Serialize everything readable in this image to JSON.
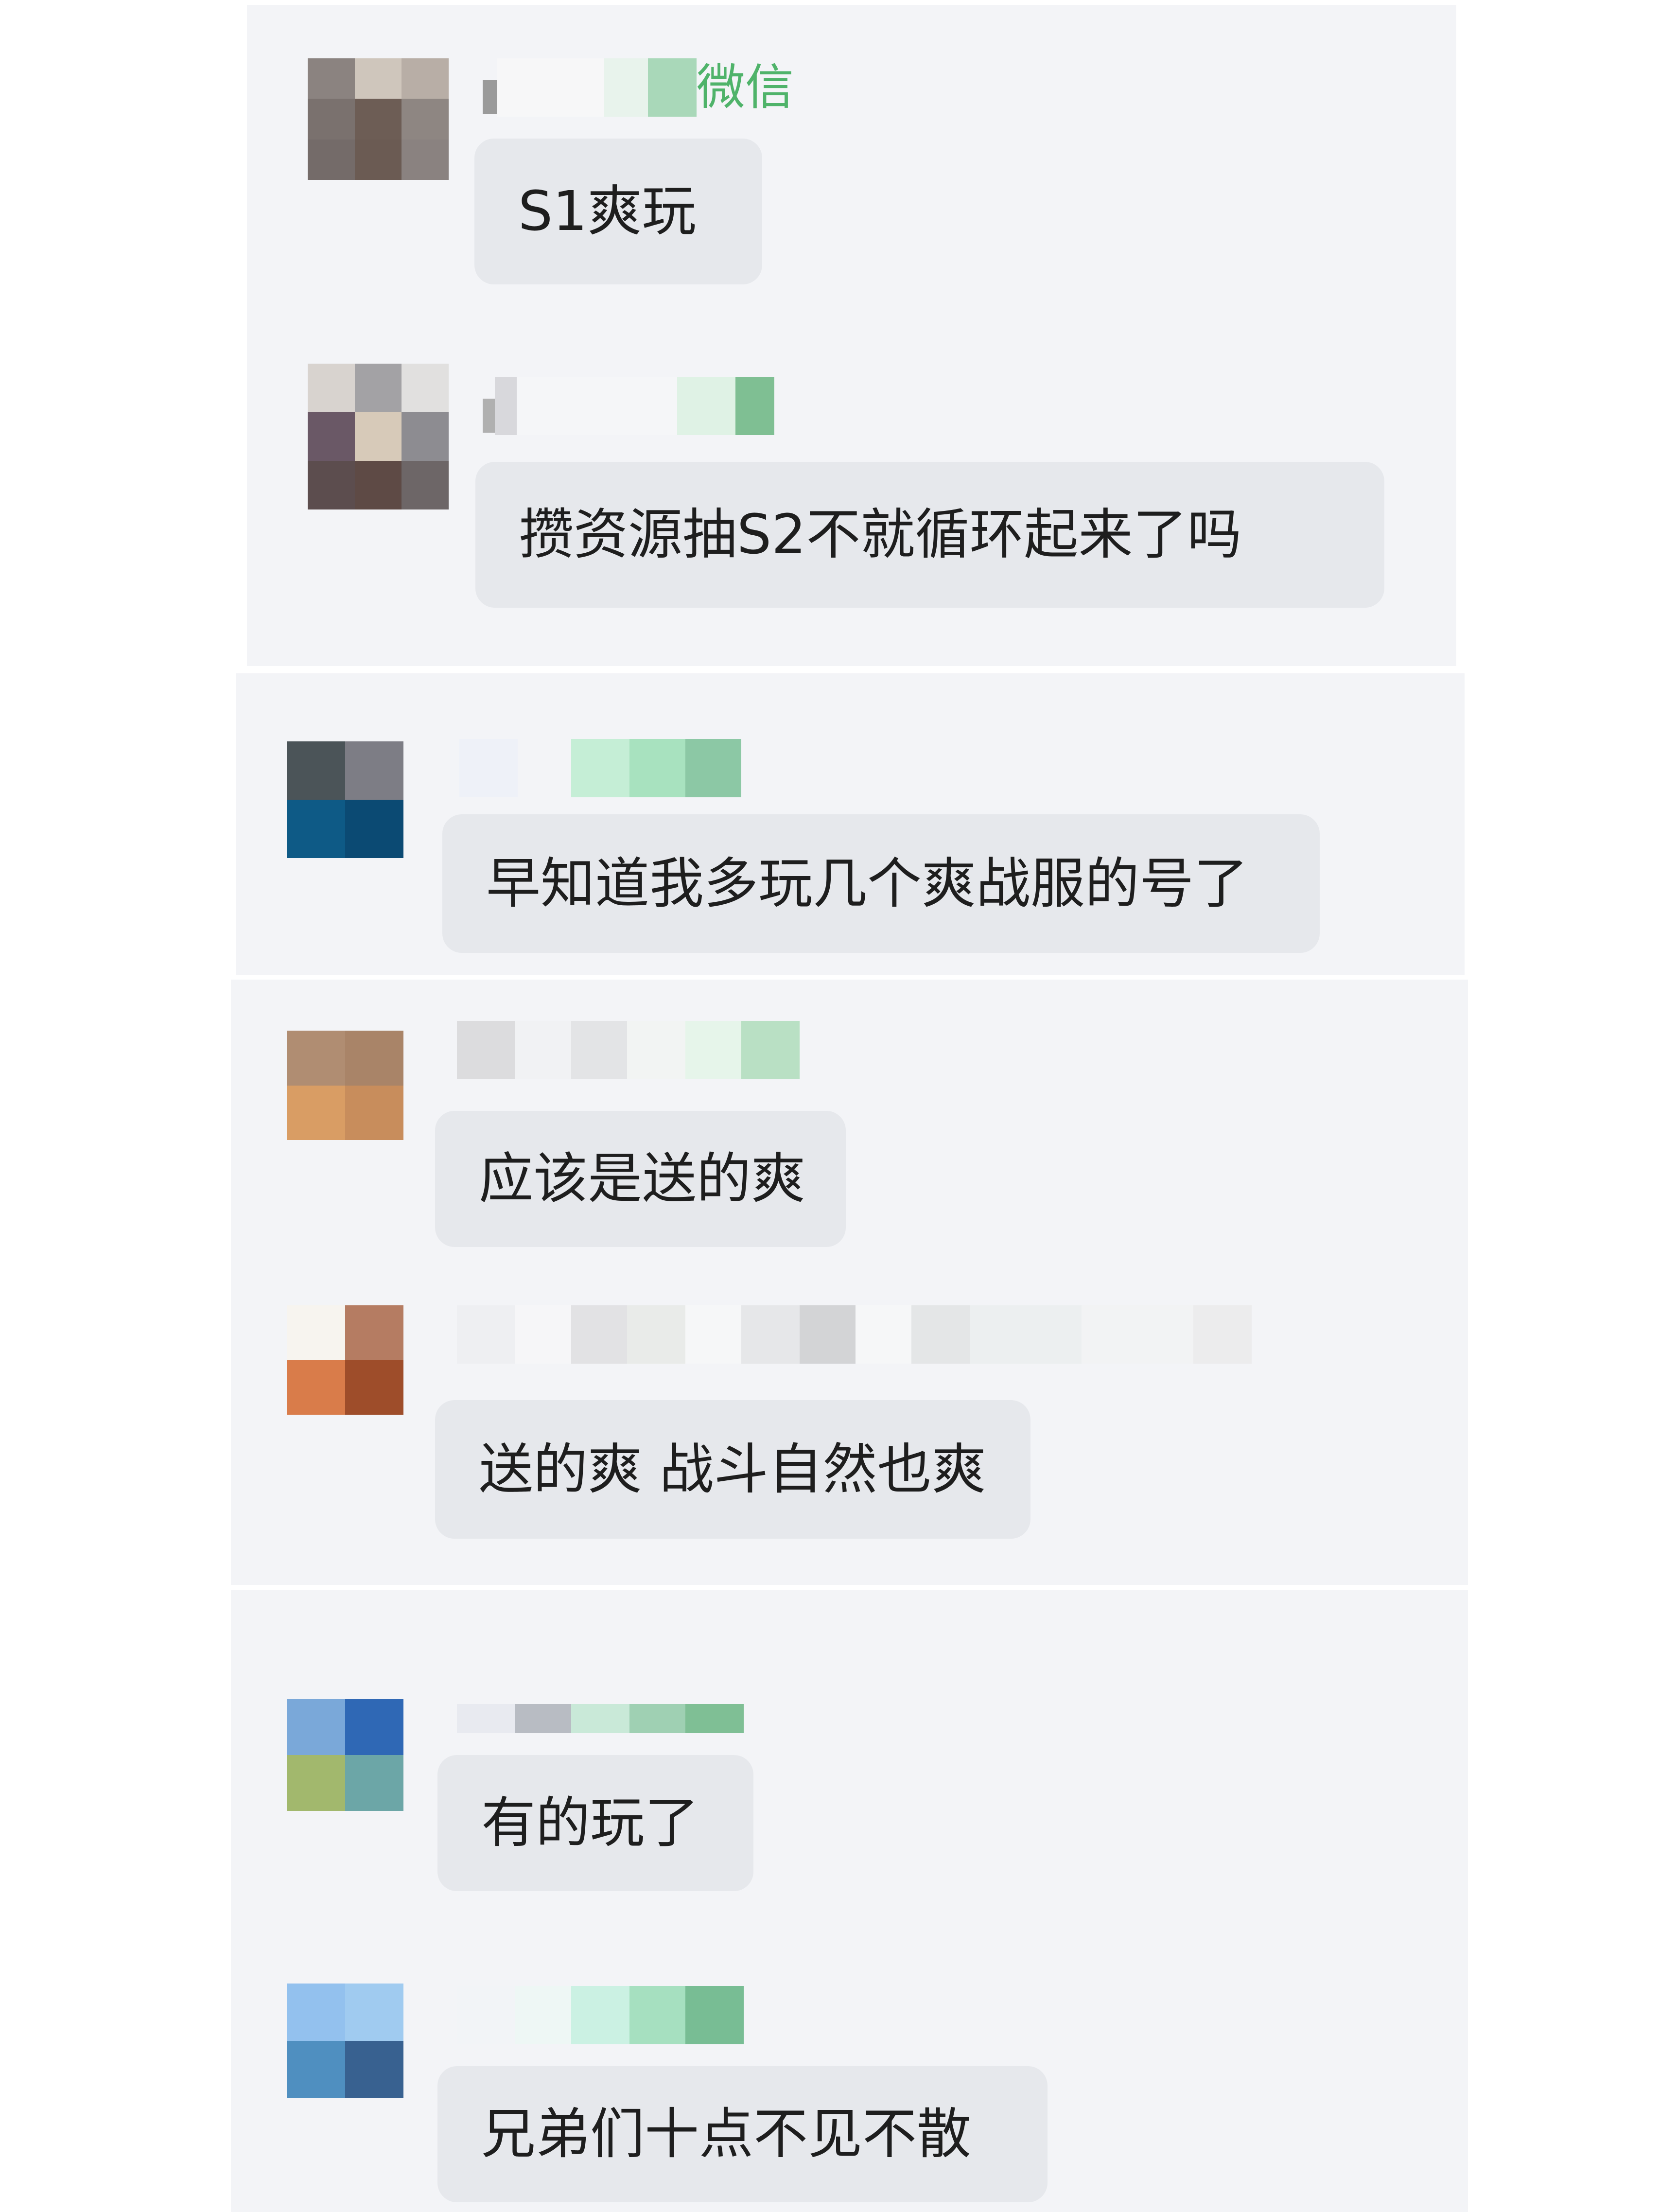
{
  "comments": [
    {
      "id": "c1",
      "sender_tag": "微信",
      "text": "S1爽玩"
    },
    {
      "id": "c2",
      "sender_tag": "",
      "text": "攒资源抽S2不就循环起来了吗"
    },
    {
      "id": "c3",
      "sender_tag": "",
      "text": "早知道我多玩几个爽战服的号了"
    },
    {
      "id": "c4",
      "sender_tag": "",
      "text": "应该是送的爽"
    },
    {
      "id": "c5",
      "sender_tag": "",
      "text": "送的爽 战斗自然也爽"
    },
    {
      "id": "c6",
      "sender_tag": "",
      "text": "有的玩了"
    },
    {
      "id": "c7",
      "sender_tag": "",
      "text": "兄弟们十点不见不散"
    }
  ],
  "colors": {
    "panel_bg": "#f3f4f7",
    "bubble_bg": "#e6e8ec",
    "text": "#1e1e1e",
    "tag": "#4fb36a"
  },
  "avatar_styles": [
    "pixelated-blur"
  ]
}
